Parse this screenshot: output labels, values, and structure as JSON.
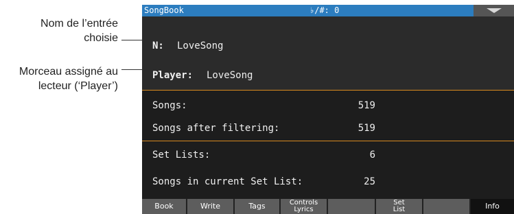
{
  "callouts": {
    "entry_name": [
      "Nom de l’entrée",
      "choisie"
    ],
    "player_song": [
      "Morceau assigné au",
      "lecteur (‘Player’)"
    ]
  },
  "titlebar": {
    "title": "SongBook",
    "keysig": "♭/#: 0",
    "menu_icon": "triangle-down-icon"
  },
  "entry": {
    "name_label": "N:",
    "name_value": "LoveSong",
    "player_label": "Player:",
    "player_value": "LoveSong"
  },
  "stats": {
    "songs_label": "Songs:",
    "songs_value": "519",
    "filtered_label": "Songs after filtering:",
    "filtered_value": "519",
    "setlists_label": "Set Lists:",
    "setlists_value": "6",
    "current_label": "Songs in current Set List:",
    "current_value": "25"
  },
  "tabs": {
    "book": "Book",
    "write": "Write",
    "tags": "Tags",
    "controls_1": "Controls",
    "controls_2": "Lyrics",
    "setlist_1": "Set",
    "setlist_2": "List",
    "info": "Info"
  }
}
